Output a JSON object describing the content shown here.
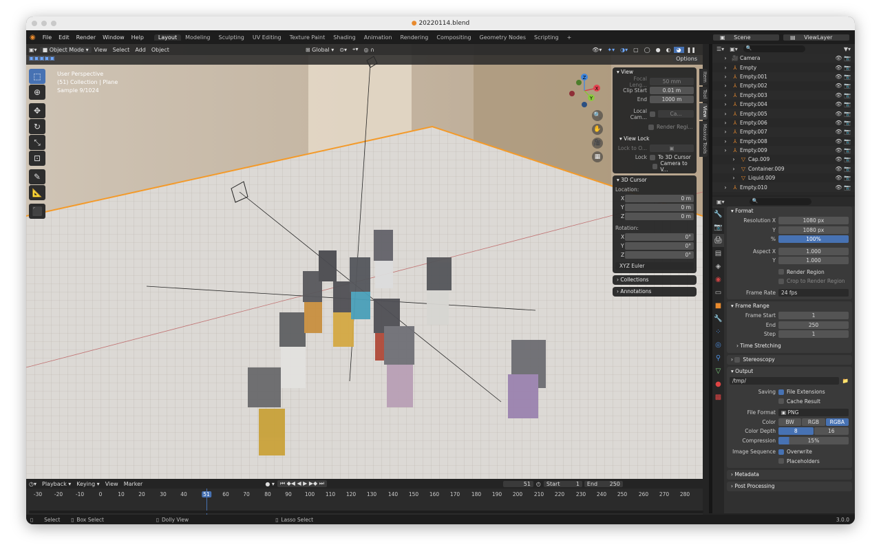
{
  "window": {
    "title": "20220114.blend"
  },
  "menu": {
    "items": [
      "File",
      "Edit",
      "Render",
      "Window",
      "Help"
    ],
    "workspaces": [
      "Layout",
      "Modeling",
      "Sculpting",
      "UV Editing",
      "Texture Paint",
      "Shading",
      "Animation",
      "Rendering",
      "Compositing",
      "Geometry Nodes",
      "Scripting"
    ],
    "plus": "+",
    "scene": "Scene",
    "view_layer": "ViewLayer"
  },
  "viewport_header": {
    "mode": "Object Mode",
    "menus": [
      "View",
      "Select",
      "Add",
      "Object"
    ],
    "orientation": "Global",
    "options": "Options"
  },
  "overlay": {
    "line1": "User Perspective",
    "line2": "(51) Collection | Plane",
    "line3": "Sample 9/1024"
  },
  "gizmo": {
    "x": "X",
    "y": "Y",
    "z": "Z"
  },
  "n_panel": {
    "view": {
      "title": "View",
      "focal_label": "Focal Leng...",
      "focal_value": "50 mm",
      "clip_start_label": "Clip Start",
      "clip_start_value": "0.01 m",
      "end_label": "End",
      "end_value": "1000 m",
      "local_cam_label": "Local Cam...",
      "local_cam_value": "Ca...",
      "render_region": "Render Regi..."
    },
    "view_lock": {
      "title": "View Lock",
      "lock_to_label": "Lock to O...",
      "lock_label": "Lock",
      "to_3d_cursor": "To 3D Cursor",
      "camera_to_view": "Camera to V..."
    },
    "cursor": {
      "title": "3D Cursor",
      "location_label": "Location:",
      "x_label": "X",
      "x_value": "0 m",
      "y_label": "Y",
      "y_value": "0 m",
      "z_label": "Z",
      "z_value": "0 m",
      "rotation_label": "Rotation:",
      "rx_label": "X",
      "rx_value": "0°",
      "ry_label": "Y",
      "ry_value": "0°",
      "rz_label": "Z",
      "rz_value": "0°",
      "mode": "XYZ Euler"
    },
    "collections": {
      "title": "Collections"
    },
    "annotations": {
      "title": "Annotations"
    },
    "tabs": [
      "Item",
      "Tool",
      "View",
      "Maxivz Tools"
    ]
  },
  "outliner": {
    "rows": [
      {
        "name": "Camera",
        "indent": 0
      },
      {
        "name": "Empty",
        "indent": 0
      },
      {
        "name": "Empty.001",
        "indent": 0
      },
      {
        "name": "Empty.002",
        "indent": 0
      },
      {
        "name": "Empty.003",
        "indent": 0
      },
      {
        "name": "Empty.004",
        "indent": 0
      },
      {
        "name": "Empty.005",
        "indent": 0
      },
      {
        "name": "Empty.006",
        "indent": 0
      },
      {
        "name": "Empty.007",
        "indent": 0
      },
      {
        "name": "Empty.008",
        "indent": 0
      },
      {
        "name": "Empty.009",
        "indent": 0
      },
      {
        "name": "Cap.009",
        "indent": 1
      },
      {
        "name": "Container.009",
        "indent": 1
      },
      {
        "name": "Liquid.009",
        "indent": 1
      },
      {
        "name": "Empty.010",
        "indent": 0
      }
    ]
  },
  "properties": {
    "format": {
      "title": "Format",
      "res_x_label": "Resolution X",
      "res_x": "1080 px",
      "res_y_label": "Y",
      "res_y": "1080 px",
      "pct_label": "%",
      "pct": "100%",
      "aspect_x_label": "Aspect X",
      "aspect_x": "1.000",
      "aspect_y_label": "Y",
      "aspect_y": "1.000",
      "render_region": "Render Region",
      "crop": "Crop to Render Region",
      "frame_rate_label": "Frame Rate",
      "frame_rate": "24 fps"
    },
    "frame_range": {
      "title": "Frame Range",
      "start_label": "Frame Start",
      "start": "1",
      "end_label": "End",
      "end": "250",
      "step_label": "Step",
      "step": "1"
    },
    "time_stretching": {
      "title": "Time Stretching"
    },
    "stereoscopy": {
      "title": "Stereoscopy"
    },
    "output": {
      "title": "Output",
      "path": "/tmp/",
      "saving_label": "Saving",
      "file_ext": "File Extensions",
      "cache": "Cache Result",
      "format_label": "File Format",
      "format": "PNG",
      "color_label": "Color",
      "color_opts": [
        "BW",
        "RGB",
        "RGBA"
      ],
      "depth_label": "Color Depth",
      "depth_opts": [
        "8",
        "16"
      ],
      "compression_label": "Compression",
      "compression": "15%",
      "seq_label": "Image Sequence",
      "overwrite": "Overwrite",
      "placeholders": "Placeholders"
    },
    "metadata": {
      "title": "Metadata"
    },
    "post": {
      "title": "Post Processing"
    }
  },
  "timeline": {
    "menus": [
      "Playback",
      "Keying",
      "View",
      "Marker"
    ],
    "current": "51",
    "start_label": "Start",
    "start": "1",
    "end_label": "End",
    "end": "250",
    "ticks": [
      "-30",
      "-20",
      "-10",
      "0",
      "10",
      "20",
      "30",
      "40",
      "51",
      "60",
      "70",
      "80",
      "90",
      "100",
      "110",
      "120",
      "130",
      "140",
      "150",
      "160",
      "170",
      "180",
      "190",
      "200",
      "210",
      "220",
      "230",
      "240",
      "250",
      "260",
      "270",
      "280"
    ]
  },
  "status": {
    "select": "Select",
    "box_select": "Box Select",
    "dolly": "Dolly View",
    "lasso": "Lasso Select",
    "version": "3.0.0"
  },
  "colors": {
    "accent": "#4772b3",
    "orange": "#e88a2e"
  }
}
